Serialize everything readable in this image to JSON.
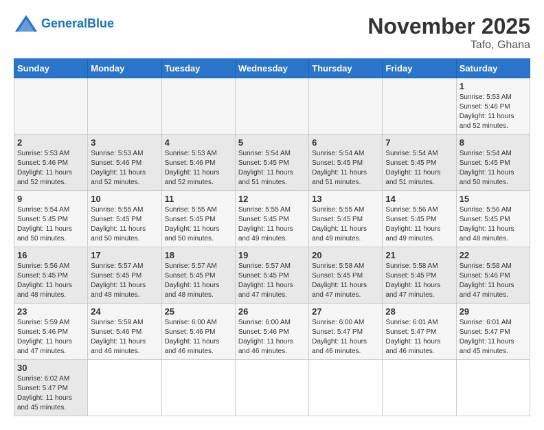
{
  "logo": {
    "general": "General",
    "blue": "Blue"
  },
  "title": "November 2025",
  "subtitle": "Tafo, Ghana",
  "weekdays": [
    "Sunday",
    "Monday",
    "Tuesday",
    "Wednesday",
    "Thursday",
    "Friday",
    "Saturday"
  ],
  "weeks": [
    [
      {
        "day": "",
        "info": ""
      },
      {
        "day": "",
        "info": ""
      },
      {
        "day": "",
        "info": ""
      },
      {
        "day": "",
        "info": ""
      },
      {
        "day": "",
        "info": ""
      },
      {
        "day": "",
        "info": ""
      },
      {
        "day": "1",
        "info": "Sunrise: 5:53 AM\nSunset: 5:46 PM\nDaylight: 11 hours and 52 minutes."
      }
    ],
    [
      {
        "day": "2",
        "info": "Sunrise: 5:53 AM\nSunset: 5:46 PM\nDaylight: 11 hours and 52 minutes."
      },
      {
        "day": "3",
        "info": "Sunrise: 5:53 AM\nSunset: 5:46 PM\nDaylight: 11 hours and 52 minutes."
      },
      {
        "day": "4",
        "info": "Sunrise: 5:53 AM\nSunset: 5:46 PM\nDaylight: 11 hours and 52 minutes."
      },
      {
        "day": "5",
        "info": "Sunrise: 5:54 AM\nSunset: 5:45 PM\nDaylight: 11 hours and 51 minutes."
      },
      {
        "day": "6",
        "info": "Sunrise: 5:54 AM\nSunset: 5:45 PM\nDaylight: 11 hours and 51 minutes."
      },
      {
        "day": "7",
        "info": "Sunrise: 5:54 AM\nSunset: 5:45 PM\nDaylight: 11 hours and 51 minutes."
      },
      {
        "day": "8",
        "info": "Sunrise: 5:54 AM\nSunset: 5:45 PM\nDaylight: 11 hours and 50 minutes."
      }
    ],
    [
      {
        "day": "9",
        "info": "Sunrise: 5:54 AM\nSunset: 5:45 PM\nDaylight: 11 hours and 50 minutes."
      },
      {
        "day": "10",
        "info": "Sunrise: 5:55 AM\nSunset: 5:45 PM\nDaylight: 11 hours and 50 minutes."
      },
      {
        "day": "11",
        "info": "Sunrise: 5:55 AM\nSunset: 5:45 PM\nDaylight: 11 hours and 50 minutes."
      },
      {
        "day": "12",
        "info": "Sunrise: 5:55 AM\nSunset: 5:45 PM\nDaylight: 11 hours and 49 minutes."
      },
      {
        "day": "13",
        "info": "Sunrise: 5:55 AM\nSunset: 5:45 PM\nDaylight: 11 hours and 49 minutes."
      },
      {
        "day": "14",
        "info": "Sunrise: 5:56 AM\nSunset: 5:45 PM\nDaylight: 11 hours and 49 minutes."
      },
      {
        "day": "15",
        "info": "Sunrise: 5:56 AM\nSunset: 5:45 PM\nDaylight: 11 hours and 48 minutes."
      }
    ],
    [
      {
        "day": "16",
        "info": "Sunrise: 5:56 AM\nSunset: 5:45 PM\nDaylight: 11 hours and 48 minutes."
      },
      {
        "day": "17",
        "info": "Sunrise: 5:57 AM\nSunset: 5:45 PM\nDaylight: 11 hours and 48 minutes."
      },
      {
        "day": "18",
        "info": "Sunrise: 5:57 AM\nSunset: 5:45 PM\nDaylight: 11 hours and 48 minutes."
      },
      {
        "day": "19",
        "info": "Sunrise: 5:57 AM\nSunset: 5:45 PM\nDaylight: 11 hours and 47 minutes."
      },
      {
        "day": "20",
        "info": "Sunrise: 5:58 AM\nSunset: 5:45 PM\nDaylight: 11 hours and 47 minutes."
      },
      {
        "day": "21",
        "info": "Sunrise: 5:58 AM\nSunset: 5:45 PM\nDaylight: 11 hours and 47 minutes."
      },
      {
        "day": "22",
        "info": "Sunrise: 5:58 AM\nSunset: 5:46 PM\nDaylight: 11 hours and 47 minutes."
      }
    ],
    [
      {
        "day": "23",
        "info": "Sunrise: 5:59 AM\nSunset: 5:46 PM\nDaylight: 11 hours and 47 minutes."
      },
      {
        "day": "24",
        "info": "Sunrise: 5:59 AM\nSunset: 5:46 PM\nDaylight: 11 hours and 46 minutes."
      },
      {
        "day": "25",
        "info": "Sunrise: 6:00 AM\nSunset: 5:46 PM\nDaylight: 11 hours and 46 minutes."
      },
      {
        "day": "26",
        "info": "Sunrise: 6:00 AM\nSunset: 5:46 PM\nDaylight: 11 hours and 46 minutes."
      },
      {
        "day": "27",
        "info": "Sunrise: 6:00 AM\nSunset: 5:47 PM\nDaylight: 11 hours and 46 minutes."
      },
      {
        "day": "28",
        "info": "Sunrise: 6:01 AM\nSunset: 5:47 PM\nDaylight: 11 hours and 46 minutes."
      },
      {
        "day": "29",
        "info": "Sunrise: 6:01 AM\nSunset: 5:47 PM\nDaylight: 11 hours and 45 minutes."
      }
    ],
    [
      {
        "day": "30",
        "info": "Sunrise: 6:02 AM\nSunset: 5:47 PM\nDaylight: 11 hours and 45 minutes."
      },
      {
        "day": "",
        "info": ""
      },
      {
        "day": "",
        "info": ""
      },
      {
        "day": "",
        "info": ""
      },
      {
        "day": "",
        "info": ""
      },
      {
        "day": "",
        "info": ""
      },
      {
        "day": "",
        "info": ""
      }
    ]
  ]
}
